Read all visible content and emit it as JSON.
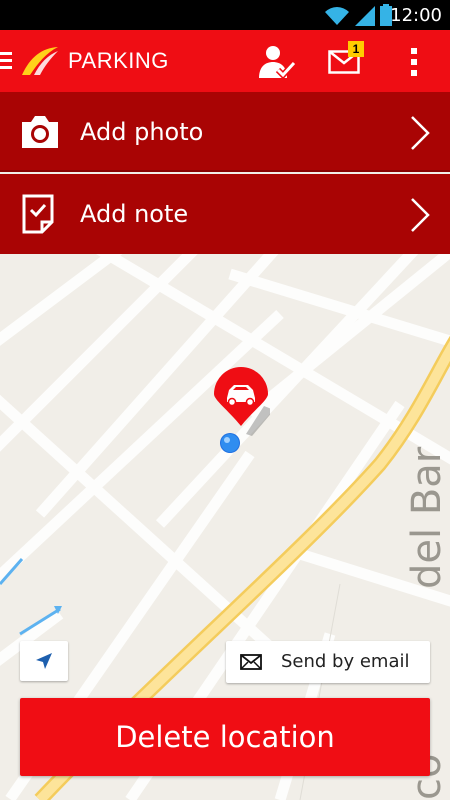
{
  "status_bar": {
    "time": "12:00"
  },
  "app_bar": {
    "title": "PARKING",
    "mail_badge": "1",
    "icons": {
      "menu": "menu-icon",
      "logo": "airline-logo-icon",
      "checkin": "checkin-icon",
      "mail": "mail-icon",
      "overflow": "overflow-menu-icon"
    }
  },
  "actions": [
    {
      "label": "Add photo",
      "icon": "camera-icon"
    },
    {
      "label": "Add note",
      "icon": "note-icon"
    }
  ],
  "map": {
    "street_label": "del Bar",
    "street_label_fragment": "co"
  },
  "buttons": {
    "send_email": "Send by email",
    "delete": "Delete location"
  },
  "colors": {
    "brand_red": "#ef0d14",
    "dark_red": "#a90404",
    "badge_yellow": "#ffcc00"
  }
}
